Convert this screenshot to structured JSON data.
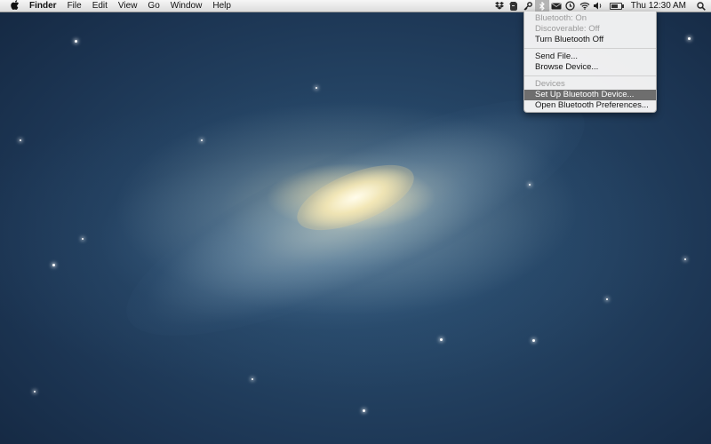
{
  "menubar": {
    "apple": "",
    "items": [
      "Finder",
      "File",
      "Edit",
      "View",
      "Go",
      "Window",
      "Help"
    ],
    "status_icons": [
      "dropbox-icon",
      "evernote-icon",
      "keychain-icon",
      "bluetooth-icon",
      "mail-icon",
      "time-machine-icon",
      "wifi-icon",
      "volume-icon",
      "battery-icon",
      "search-icon"
    ],
    "clock": "Thu 12:30 AM",
    "battery_level": 0.75
  },
  "bluetooth_menu": {
    "status_on": "Bluetooth: On",
    "discoverable": "Discoverable: Off",
    "turn_off": "Turn Bluetooth Off",
    "send_file": "Send File...",
    "browse_device": "Browse Device...",
    "devices_header": "Devices",
    "setup_device": "Set Up Bluetooth Device...",
    "open_prefs": "Open Bluetooth Preferences..."
  }
}
